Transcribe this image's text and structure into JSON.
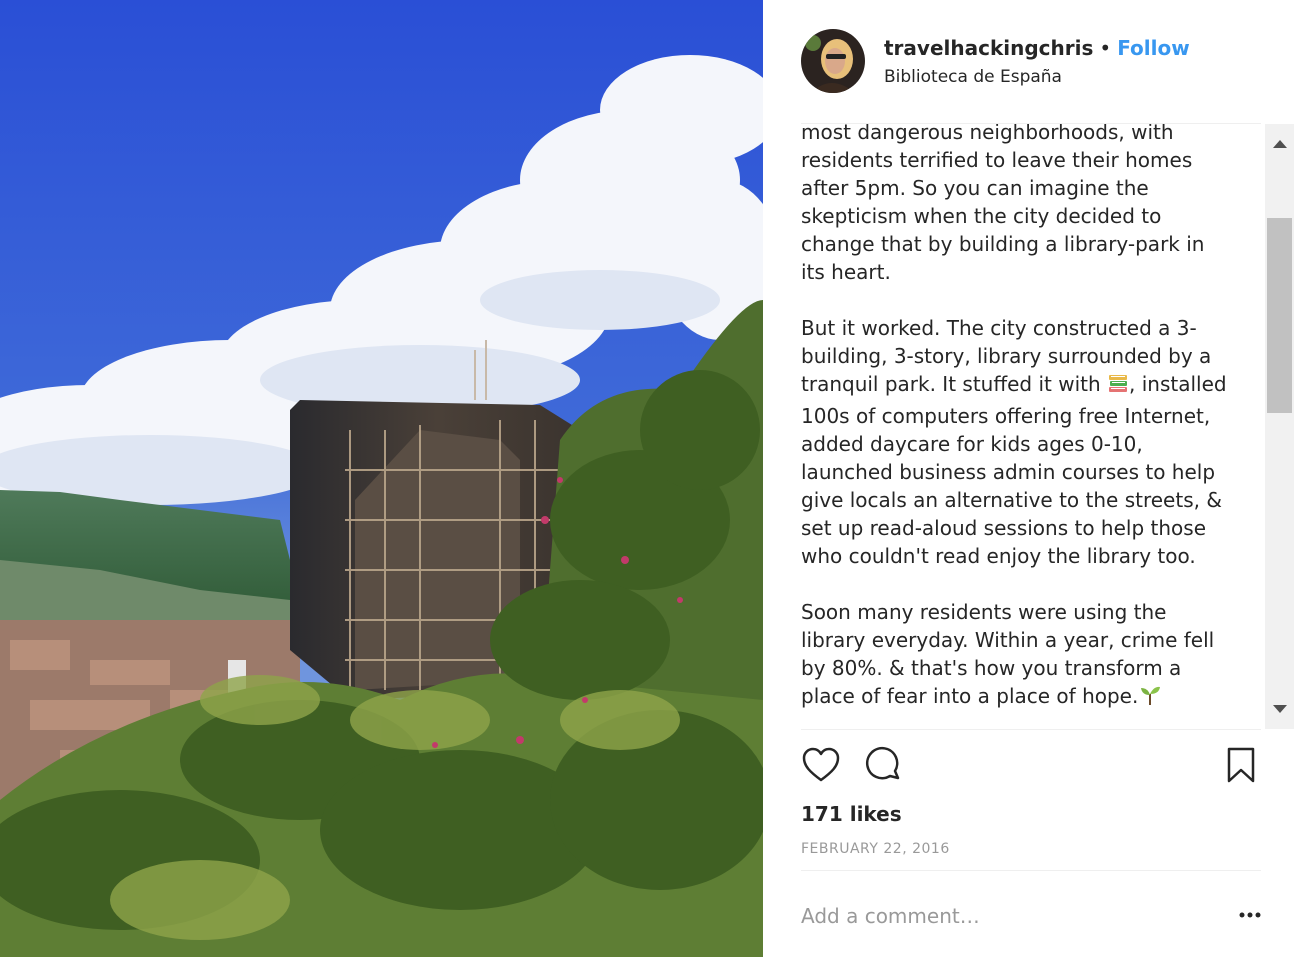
{
  "post": {
    "username": "travelhackingchris",
    "separator": "•",
    "follow_label": "Follow",
    "location": "Biblioteca de España",
    "caption_paragraphs": [
      {
        "lines": [
          "most dangerous neighborhoods, with",
          "residents terrified to leave their homes",
          "after 5pm. So you can imagine the",
          "skepticism when the city decided to",
          "change that by building a library-park in",
          "its heart."
        ]
      },
      {
        "line1": "But it worked. The city constructed a 3-",
        "line2": "building, 3-story, library surrounded by a",
        "line3_pre": "tranquil park. It stuffed it with ",
        "books_emoji": "books-emoji",
        "line3_post": ", installed",
        "rest": [
          "100s of computers offering free Internet,",
          "added daycare for kids ages 0-10,",
          "launched business admin courses to help",
          "give locals an alternative to the streets, &",
          "set up read-aloud sessions to help those",
          "who couldn't read enjoy the library too."
        ]
      },
      {
        "lines": [
          "Soon many residents were using the",
          "library everyday. Within a year, crime fell",
          "by 80%. & that's how you transform a"
        ],
        "last_line": "place of fear into a place of hope.",
        "seedling_emoji": "seedling-emoji"
      }
    ],
    "likes": "171 likes",
    "date": "FEBRUARY 22, 2016",
    "comment_placeholder": "Add a comment…",
    "icons": {
      "like": "heart-icon",
      "comment": "comment-icon",
      "save": "bookmark-icon",
      "more": "more-icon",
      "scroll_up": "arrow-up-icon",
      "scroll_down": "arrow-down-icon"
    },
    "colors": {
      "follow": "#3897f0",
      "text": "#262626",
      "muted": "#999999",
      "divider": "#efefef"
    }
  }
}
